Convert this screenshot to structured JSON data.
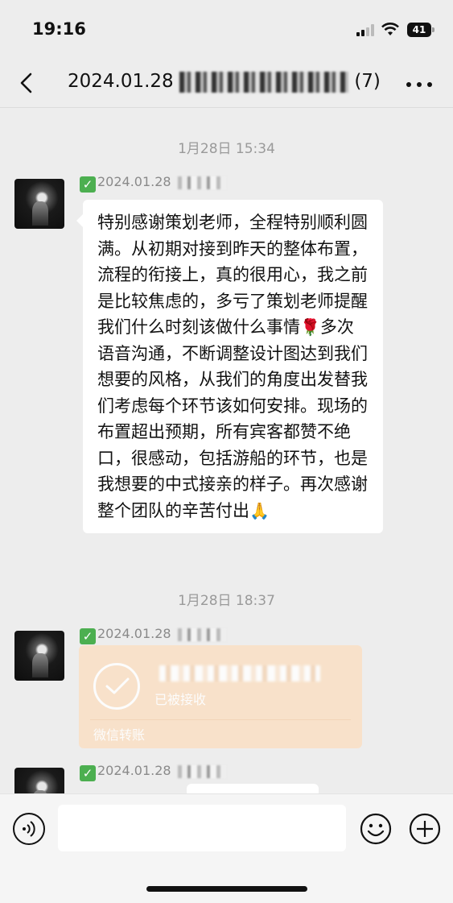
{
  "status_bar": {
    "time": "19:16",
    "battery": "41"
  },
  "nav": {
    "title_prefix": "2024.01.28 ",
    "title_suffix": "(7)"
  },
  "messages": [
    {
      "timestamp": "1月28日 15:34",
      "sender_prefix": "2024.01.28",
      "text_parts": [
        "特别感谢策划老师，全程特别顺利圆满。从初期对接到昨天的整体布置，流程的衔接上，真的很用心，我之前是比较焦虑的，多亏了策划老师提醒我们什么时刻该做什么事情",
        "多次语音沟通，不断调整设计图达到我们想要的风格，从我们的角度出发替我们考虑每个环节该如何安排。现场的布置超出预期，所有宾客都赞不绝口，很感动，包括游船的环节，也是我想要的中式接亲的样子。再次感谢整个团队的辛苦付出"
      ]
    },
    {
      "timestamp": "1月28日 18:37",
      "sender_prefix": "2024.01.28",
      "transfer": {
        "status": "已被接收",
        "footer": "微信转账"
      }
    },
    {
      "sender_prefix": "2024.01.28"
    }
  ],
  "icons": {
    "back": "chevron-left-icon",
    "more": "more-icon",
    "voice": "voice-icon",
    "emoji": "emoji-icon",
    "plus": "plus-icon",
    "check": "check-mark-icon",
    "rose": "rose-icon",
    "hands": "folded-hands-icon"
  }
}
